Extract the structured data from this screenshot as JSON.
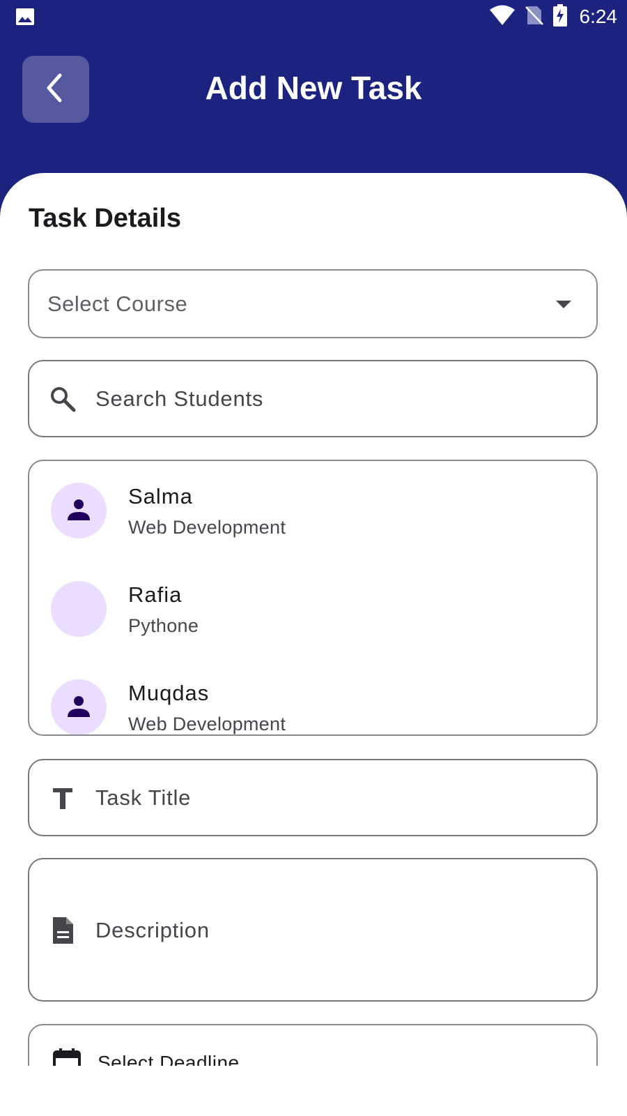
{
  "status_bar": {
    "time": "6:24",
    "icons": [
      "image-icon",
      "wifi-icon",
      "no-sim-icon",
      "battery-charging-icon"
    ]
  },
  "app_bar": {
    "title": "Add New Task",
    "back_icon": "chevron-left-icon"
  },
  "form": {
    "section_title": "Task Details",
    "course_select": {
      "placeholder": "Select Course"
    },
    "search": {
      "placeholder": "Search Students",
      "icon": "search-icon"
    },
    "students": [
      {
        "name": "Salma",
        "course": "Web Development",
        "has_icon": true
      },
      {
        "name": "Rafia",
        "course": "Pythone",
        "has_icon": false
      },
      {
        "name": "Muqdas",
        "course": "Web Development",
        "has_icon": true
      }
    ],
    "task_title": {
      "placeholder": "Task Title",
      "icon": "text-format-icon"
    },
    "description": {
      "placeholder": "Description",
      "icon": "document-icon"
    },
    "deadline": {
      "label": "Select Deadline",
      "icon": "calendar-icon"
    }
  },
  "colors": {
    "primary": "#1c237e",
    "avatar_bg": "#eaddff",
    "avatar_icon": "#21005d",
    "outline": "#8a8a90"
  }
}
